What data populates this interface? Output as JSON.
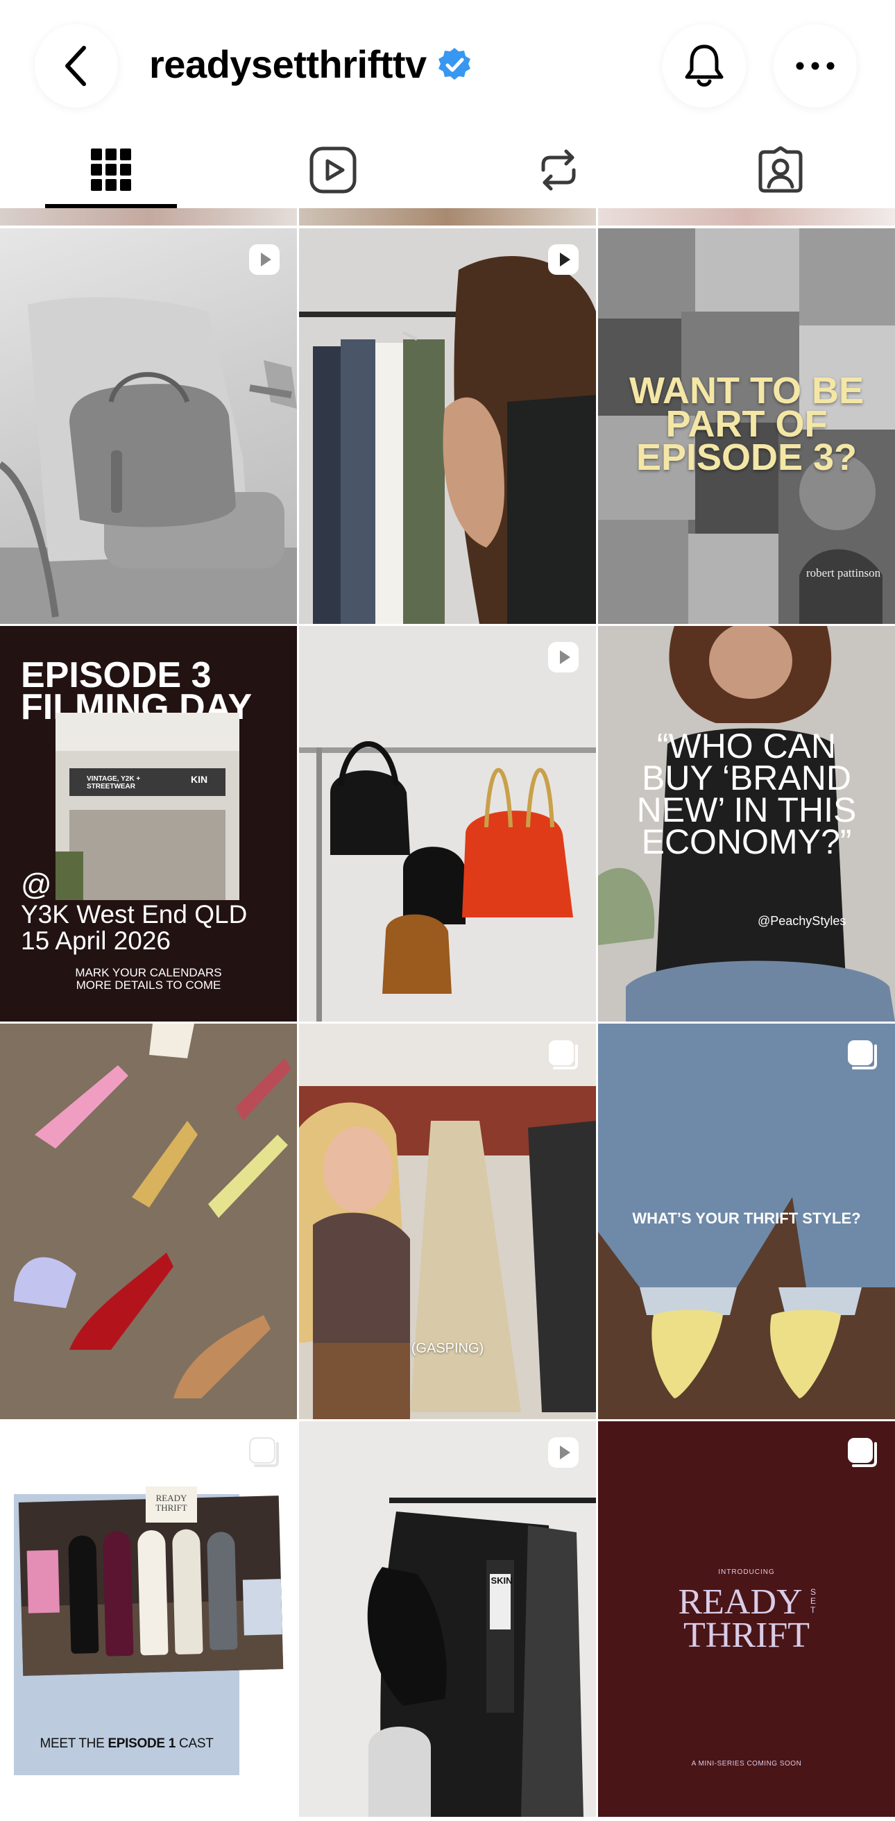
{
  "profile": {
    "username": "readysetthrifttv",
    "verified": true
  },
  "header_icons": {
    "back": "chevron-left-icon",
    "notifications": "bell-icon",
    "more": "ellipsis-icon"
  },
  "tabs": [
    {
      "name": "grid-icon",
      "active": true
    },
    {
      "name": "reels-icon",
      "active": false
    },
    {
      "name": "reposts-icon",
      "active": false
    },
    {
      "name": "tagged-icon",
      "active": false
    }
  ],
  "posts": [
    {
      "id": 1,
      "kind": "reel",
      "scene": "grey handbag on chair"
    },
    {
      "id": 2,
      "kind": "reel",
      "scene": "clothes rack"
    },
    {
      "id": 3,
      "kind": "photo",
      "overlay": "WANT TO BE PART OF EPISODE 3?",
      "caption": "robert pattinson"
    },
    {
      "id": 4,
      "kind": "photo",
      "heading": "EPISODE 3 FILMING DAY",
      "at": "@",
      "location": "Y3K West End QLD",
      "date": "15 April 2026",
      "note_line1": "MARK YOUR CALENDARS",
      "note_line2": "MORE DETAILS TO COME",
      "store_sign": "VINTAGE, Y2K + STREETWEAR",
      "store_sign2": "KIN"
    },
    {
      "id": 5,
      "kind": "reel",
      "scene": "handbags on rack"
    },
    {
      "id": 6,
      "kind": "photo",
      "quote": "“WHO CAN BUY ‘BRAND NEW’ IN THIS ECONOMY?”",
      "handle": "@PeachyStyles"
    },
    {
      "id": 7,
      "kind": "photo",
      "scene": "shoes on carpet"
    },
    {
      "id": 8,
      "kind": "carousel",
      "caption": "(GASPING)"
    },
    {
      "id": 9,
      "kind": "carousel",
      "overlay": "WHAT’S YOUR THRIFT STYLE?"
    },
    {
      "id": 10,
      "kind": "carousel",
      "caption_prefix": "MEET THE ",
      "caption_bold": "EPISODE 1",
      "caption_suffix": " CAST",
      "sign": "READY THRIFT"
    },
    {
      "id": 11,
      "kind": "reel",
      "scene": "black bags on rack",
      "tag": "SKIN"
    },
    {
      "id": 12,
      "kind": "carousel",
      "intro": "INTRODUCING",
      "title_line1": "READY",
      "title_set": "SET",
      "title_line2": "THRIFT",
      "tagline": "A MINI-SERIES COMING SOON"
    }
  ],
  "colors": {
    "verified_blue": "#3897F0",
    "maroon": "#4a1517",
    "dark_brown": "#231212",
    "cream_text": "#f4e7a6",
    "title_lilac": "#d9cde8"
  }
}
